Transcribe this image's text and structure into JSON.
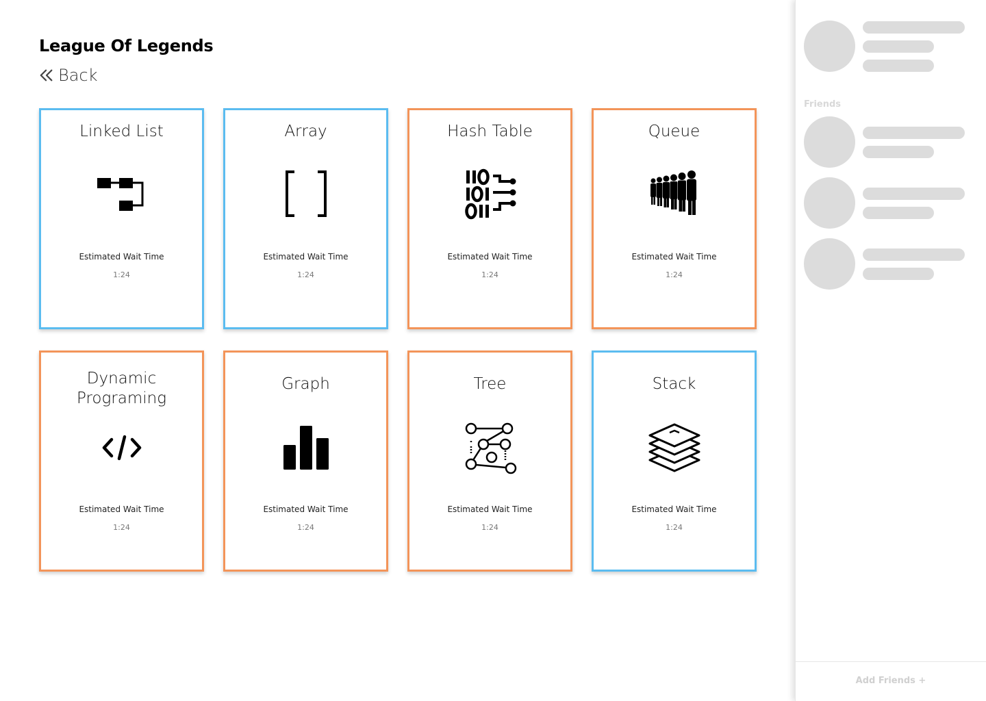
{
  "header": {
    "title": "League Of Legends",
    "back_label": "Back"
  },
  "cards": [
    {
      "title": "Linked List",
      "wait_label": "Estimated Wait Time",
      "wait_time": "1:24",
      "icon": "linked-list-icon",
      "accent": "#5bbcf0"
    },
    {
      "title": "Array",
      "wait_label": "Estimated Wait Time",
      "wait_time": "1:24",
      "icon": "brackets-icon",
      "accent": "#5bbcf0"
    },
    {
      "title": "Hash Table",
      "wait_label": "Estimated Wait Time",
      "wait_time": "1:24",
      "icon": "binary-circuit-icon",
      "accent": "#f39459"
    },
    {
      "title": "Queue",
      "wait_label": "Estimated Wait Time",
      "wait_time": "1:24",
      "icon": "people-line-icon",
      "accent": "#f39459"
    },
    {
      "title_line1": "Dynamic",
      "title_line2": "Programing",
      "wait_label": "Estimated Wait Time",
      "wait_time": "1:24",
      "icon": "code-icon",
      "accent": "#f39459"
    },
    {
      "title": "Graph",
      "wait_label": "Estimated Wait Time",
      "wait_time": "1:24",
      "icon": "bar-chart-icon",
      "accent": "#f39459"
    },
    {
      "title": "Tree",
      "wait_label": "Estimated Wait Time",
      "wait_time": "1:24",
      "icon": "node-tree-icon",
      "accent": "#f39459"
    },
    {
      "title": "Stack",
      "wait_label": "Estimated Wait Time",
      "wait_time": "1:24",
      "icon": "layers-icon",
      "accent": "#5bbcf0"
    }
  ],
  "sidebar": {
    "friends_label": "Friends",
    "add_friends_label": "Add Friends +"
  },
  "colors": {
    "blue_accent": "#5bbcf0",
    "orange_accent": "#f39459",
    "placeholder": "#dcdcdc"
  }
}
